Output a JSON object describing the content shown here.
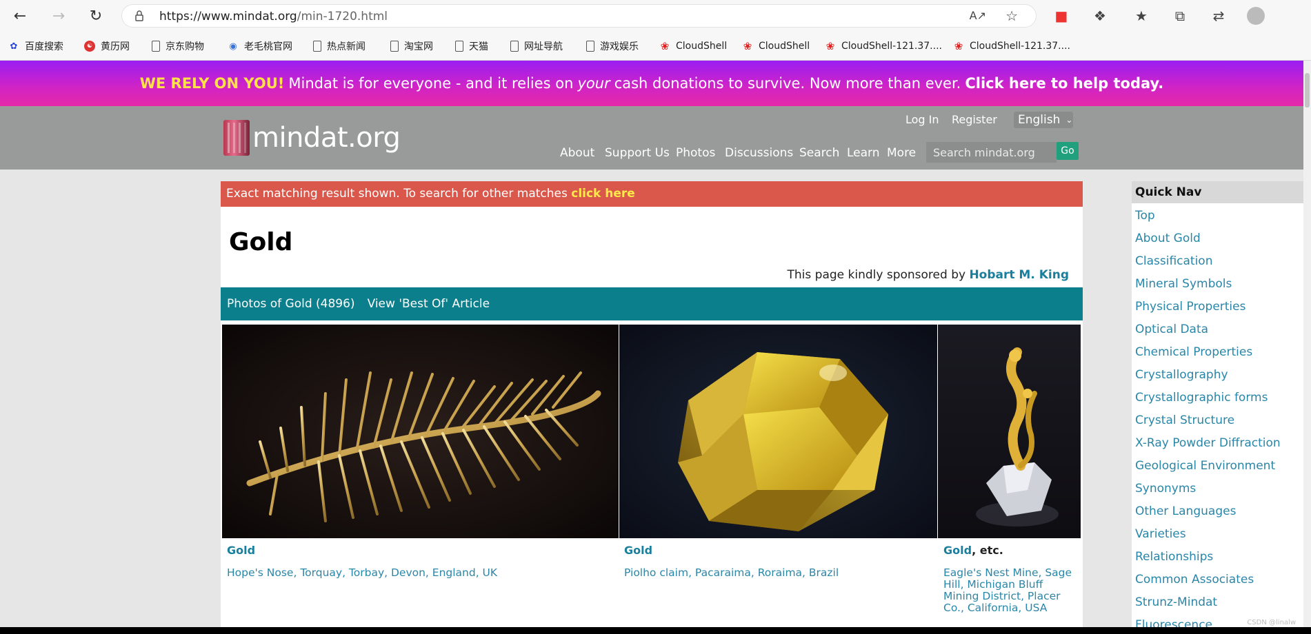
{
  "browser": {
    "url_main": "https://www.mindat.org",
    "url_path": "/min-1720.html",
    "bookmarks": [
      "百度搜索",
      "黄历网",
      "京东购物",
      "老毛桃官网",
      "热点新闻",
      "淘宝网",
      "天猫",
      "网址导航",
      "游戏娱乐",
      "CloudShell",
      "CloudShell",
      "CloudShell-121.37....",
      "CloudShell-121.37...."
    ]
  },
  "banner": {
    "highlight": "WE RELY ON YOU!",
    "text1": "Mindat is for everyone - and it relies on",
    "emph": "your",
    "text2": "cash donations to survive. Now more than ever.",
    "cta": "Click here to help today."
  },
  "header": {
    "logo": "mindat.org",
    "login": "Log In",
    "register": "Register",
    "language": "English",
    "menu": [
      "About",
      "Support Us",
      "Photos",
      "Discussions",
      "Search",
      "Learn",
      "More"
    ],
    "search_placeholder": "Search mindat.org",
    "go": "Go"
  },
  "alert": {
    "text": "Exact matching result shown. To search for other matches",
    "link": "click here"
  },
  "page": {
    "title": "Gold",
    "sponsor_text": "This page kindly sponsored by",
    "sponsor_name": "Hobart M. King",
    "tabs": [
      "Photos of Gold (4896)",
      "View 'Best Of' Article"
    ]
  },
  "photos": [
    {
      "title": "Gold",
      "suffix": "",
      "location": "Hope's Nose, Torquay, Torbay, Devon, England, UK"
    },
    {
      "title": "Gold",
      "suffix": "",
      "location": "Piolho claim, Pacaraima, Roraima, Brazil"
    },
    {
      "title": "Gold",
      "suffix": ", etc.",
      "location": "Eagle's Nest Mine, Sage Hill, Michigan Bluff Mining District, Placer Co., California, USA"
    }
  ],
  "quicknav": {
    "heading": "Quick Nav",
    "items": [
      "Top",
      "About Gold",
      "Classification",
      "Mineral Symbols",
      "Physical Properties",
      "Optical Data",
      "Chemical Properties",
      "Crystallography",
      "Crystallographic forms",
      "Crystal Structure",
      "X-Ray Powder Diffraction",
      "Geological Environment",
      "Synonyms",
      "Other Languages",
      "Varieties",
      "Relationships",
      "Common Associates",
      "Strunz-Mindat",
      "Fluorescence"
    ]
  },
  "watermark": "CSDN @linalw"
}
